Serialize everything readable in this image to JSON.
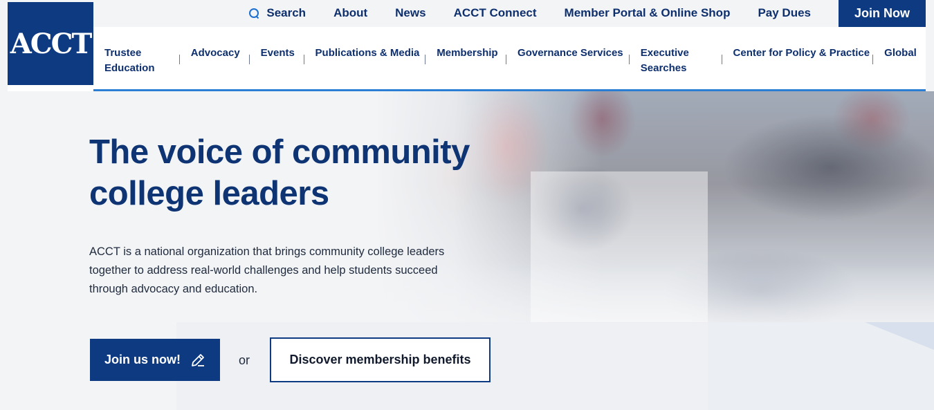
{
  "top_bar": {
    "search_label": "Search",
    "links": [
      "About",
      "News",
      "ACCT Connect",
      "Member Portal & Online Shop",
      "Pay Dues"
    ],
    "join_label": "Join Now"
  },
  "logo": {
    "text": "ACCT"
  },
  "main_nav": {
    "items": [
      {
        "line1": "Trustee",
        "line2": "Education"
      },
      {
        "line1": "Advocacy",
        "line2": ""
      },
      {
        "line1": "Events",
        "line2": ""
      },
      {
        "line1": "Publications & Media",
        "line2": ""
      },
      {
        "line1": "Membership",
        "line2": ""
      },
      {
        "line1": "Governance Services",
        "line2": ""
      },
      {
        "line1": "Executive",
        "line2": "Searches"
      },
      {
        "line1": "Center for Policy & Practice",
        "line2": ""
      },
      {
        "line1": "Global",
        "line2": ""
      }
    ]
  },
  "hero": {
    "headline": "The voice of community college leaders",
    "intro": "ACCT is a national organization that brings community college leaders together to address real-world challenges and help students succeed through advocacy and education.",
    "join_button": "Join us now!",
    "or_text": "or",
    "discover_button": "Discover membership benefits"
  },
  "colors": {
    "brand_navy": "#0e3a82",
    "accent_blue": "#2a7fd4",
    "search_icon": "#1a6fd1"
  },
  "icons": {
    "search": "search-icon",
    "pencil": "pencil-icon"
  }
}
